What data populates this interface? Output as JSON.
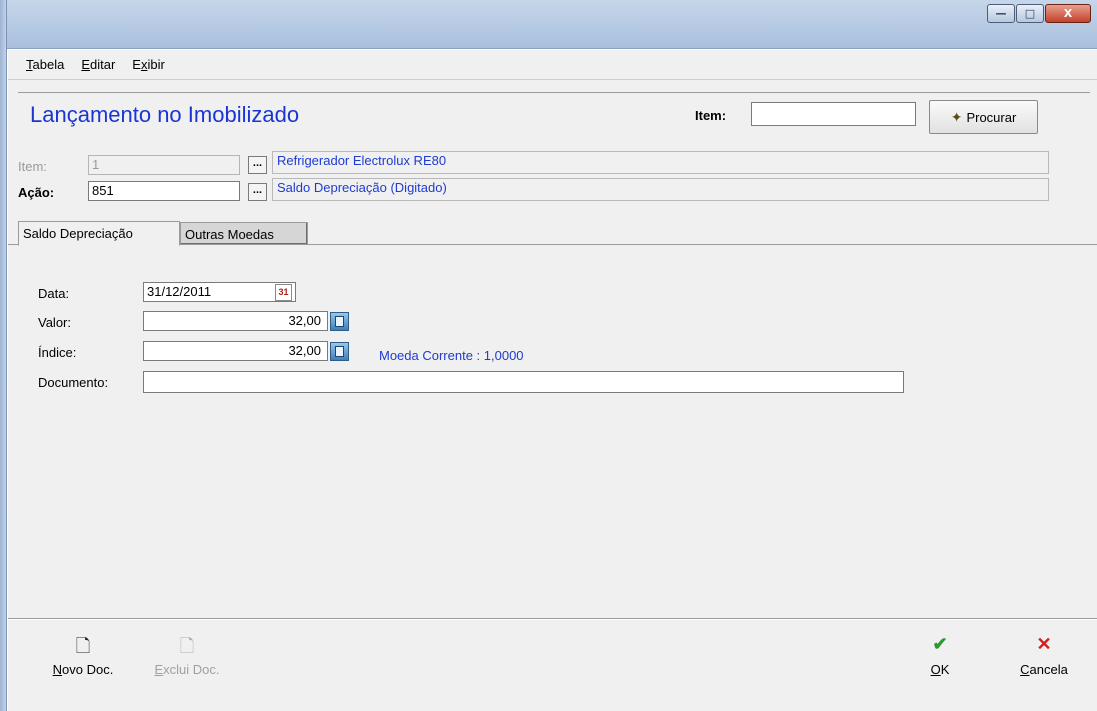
{
  "window": {
    "buttons": {
      "minimize": "—",
      "maximize": "□",
      "close": "X"
    }
  },
  "menu": [
    {
      "label": "Tabela",
      "ul": "T",
      "rest": "abela"
    },
    {
      "label": "Editar",
      "ul": "E",
      "rest": "ditar"
    },
    {
      "label": "Exibir",
      "ul": "x",
      "rest": "ibir",
      "pre": "E"
    }
  ],
  "header": {
    "title": "Lançamento no Imobilizado",
    "item_label": "Item:",
    "item_value": "",
    "search_button": "Procurar"
  },
  "record": {
    "item_label": "Item:",
    "item_value": "1",
    "item_desc": "Refrigerador Electrolux RE80",
    "acao_label": "Ação:",
    "acao_value": "851",
    "acao_desc": "Saldo Depreciação (Digitado)",
    "ellipsis": "..."
  },
  "tabs": [
    {
      "label": "Saldo Depreciação",
      "active": true
    },
    {
      "label": "Outras Moedas",
      "active": false
    }
  ],
  "form": {
    "data_label": "Data:",
    "data_value": "31/12/2011",
    "valor_label": "Valor:",
    "valor_value": "32,00",
    "indice_label": "Índice:",
    "indice_value": "32,00",
    "moeda_text": "Moeda Corrente :  1,0000",
    "documento_label": "Documento:",
    "documento_value": ""
  },
  "footer": {
    "novo_doc": {
      "ul": "N",
      "rest": "ovo Doc."
    },
    "exclui_doc": {
      "ul": "E",
      "rest": "xclui Doc."
    },
    "ok": {
      "ul": "O",
      "rest": "K"
    },
    "cancela": {
      "ul": "C",
      "rest": "ancela"
    }
  },
  "colors": {
    "title": "#1b35d4",
    "link_text": "#1f3bd0",
    "ok_icon": "#2e9a2e",
    "cancel_icon": "#d22020"
  }
}
